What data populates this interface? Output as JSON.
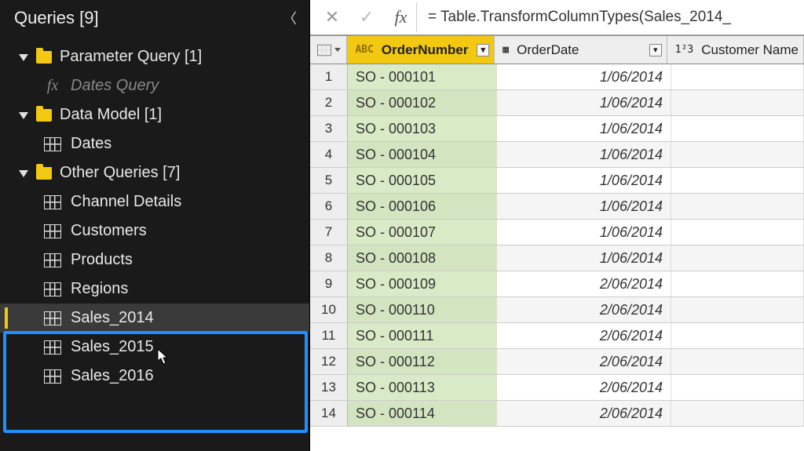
{
  "sidebar": {
    "title": "Queries [9]",
    "groups": [
      {
        "label": "Parameter Query [1]",
        "items": [
          {
            "label": "Dates Query",
            "kind": "fx",
            "muted": true
          }
        ]
      },
      {
        "label": "Data Model [1]",
        "items": [
          {
            "label": "Dates",
            "kind": "table"
          }
        ]
      },
      {
        "label": "Other Queries [7]",
        "items": [
          {
            "label": "Channel Details",
            "kind": "table"
          },
          {
            "label": "Customers",
            "kind": "table"
          },
          {
            "label": "Products",
            "kind": "table"
          },
          {
            "label": "Regions",
            "kind": "table"
          },
          {
            "label": "Sales_2014",
            "kind": "table",
            "selected": true
          },
          {
            "label": "Sales_2015",
            "kind": "table"
          },
          {
            "label": "Sales_2016",
            "kind": "table"
          }
        ]
      }
    ]
  },
  "formula": "= Table.TransformColumnTypes(Sales_2014_",
  "columns": [
    {
      "label": "OrderNumber",
      "type_badge": "ABC",
      "selected": true
    },
    {
      "label": "OrderDate",
      "type_badge": "▦"
    },
    {
      "label": "Customer Name",
      "type_badge": "1²3"
    }
  ],
  "rows": [
    {
      "n": "1",
      "order": "SO - 000101",
      "date": "1/06/2014"
    },
    {
      "n": "2",
      "order": "SO - 000102",
      "date": "1/06/2014"
    },
    {
      "n": "3",
      "order": "SO - 000103",
      "date": "1/06/2014"
    },
    {
      "n": "4",
      "order": "SO - 000104",
      "date": "1/06/2014"
    },
    {
      "n": "5",
      "order": "SO - 000105",
      "date": "1/06/2014"
    },
    {
      "n": "6",
      "order": "SO - 000106",
      "date": "1/06/2014"
    },
    {
      "n": "7",
      "order": "SO - 000107",
      "date": "1/06/2014"
    },
    {
      "n": "8",
      "order": "SO - 000108",
      "date": "1/06/2014"
    },
    {
      "n": "9",
      "order": "SO - 000109",
      "date": "2/06/2014"
    },
    {
      "n": "10",
      "order": "SO - 000110",
      "date": "2/06/2014"
    },
    {
      "n": "11",
      "order": "SO - 000111",
      "date": "2/06/2014"
    },
    {
      "n": "12",
      "order": "SO - 000112",
      "date": "2/06/2014"
    },
    {
      "n": "13",
      "order": "SO - 000113",
      "date": "2/06/2014"
    },
    {
      "n": "14",
      "order": "SO - 000114",
      "date": "2/06/2014"
    }
  ]
}
